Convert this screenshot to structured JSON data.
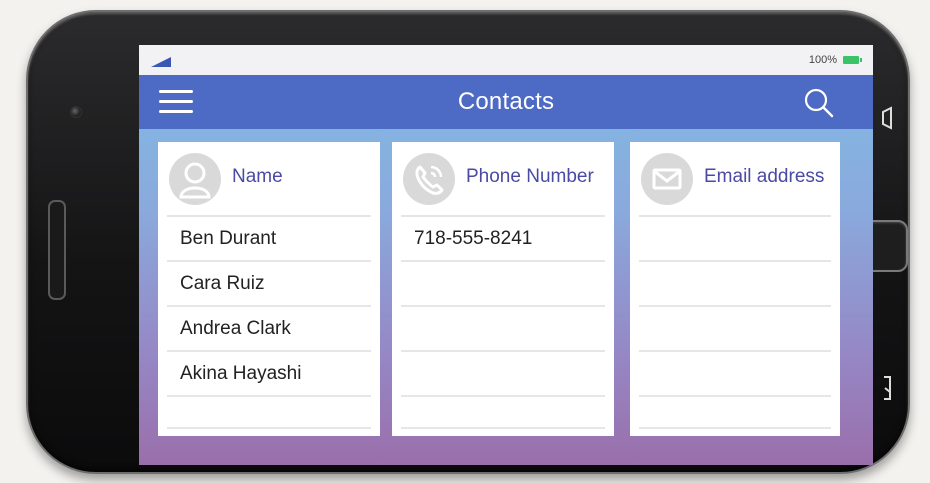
{
  "status": {
    "battery_text": "100%"
  },
  "app": {
    "title": "Contacts"
  },
  "icons": {
    "menu": "hamburger-menu-icon",
    "search": "search-icon",
    "person": "person-icon",
    "phone": "phone-icon",
    "mail": "mail-icon"
  },
  "columns": [
    {
      "label": "Name",
      "rows": [
        "Ben Durant",
        "Cara Ruiz",
        "Andrea Clark",
        "Akina Hayashi",
        ""
      ]
    },
    {
      "label": "Phone Number",
      "rows": [
        "718-555-8241",
        "",
        "",
        "",
        ""
      ]
    },
    {
      "label": "Email address",
      "rows": [
        "",
        "",
        "",
        "",
        ""
      ]
    }
  ],
  "colors": {
    "appbar": "#4d6ac4",
    "accent_text": "#4a4aa5",
    "battery": "#3cc36a"
  }
}
